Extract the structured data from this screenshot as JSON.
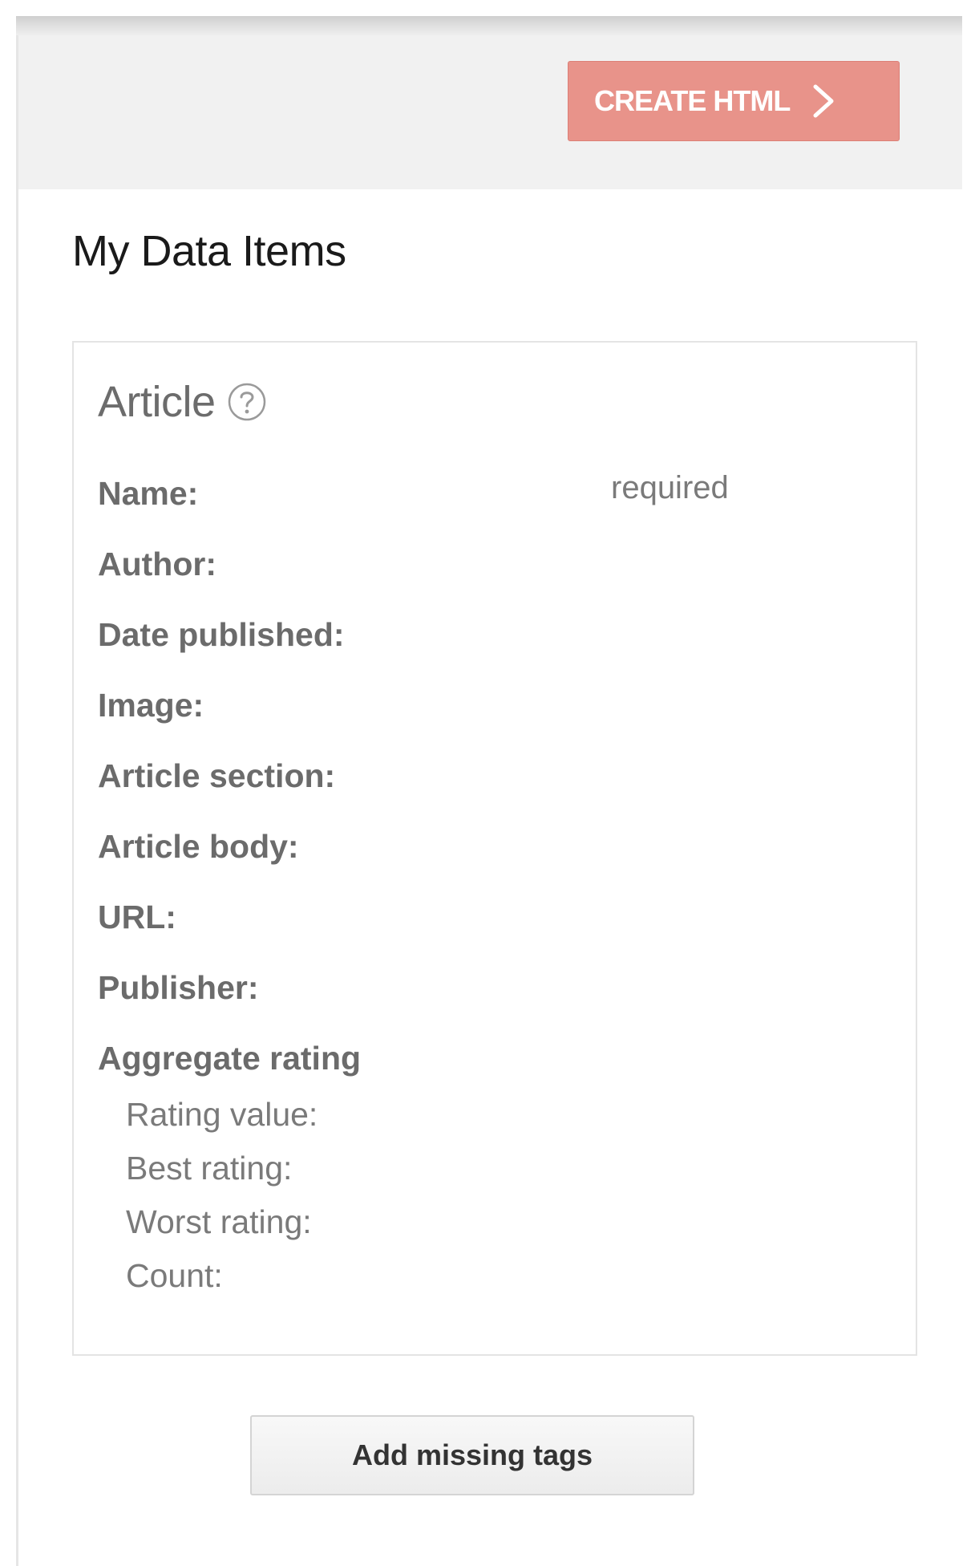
{
  "toolbar": {
    "create_button_label": "CREATE HTML",
    "create_button_icon": "chevron-right-icon",
    "create_button_color": "#e8938a"
  },
  "page": {
    "title": "My Data Items"
  },
  "item": {
    "type_title": "Article",
    "help_icon": "question-circle-icon",
    "required_note": "required",
    "fields": [
      "Name:",
      "Author:",
      "Date published:",
      "Image:",
      "Article section:",
      "Article body:",
      "URL:",
      "Publisher:",
      "Aggregate rating"
    ],
    "aggregate_rating_fields": [
      "Rating value:",
      "Best rating:",
      "Worst rating:",
      "Count:"
    ]
  },
  "footer": {
    "add_missing_tags_label": "Add missing tags"
  }
}
